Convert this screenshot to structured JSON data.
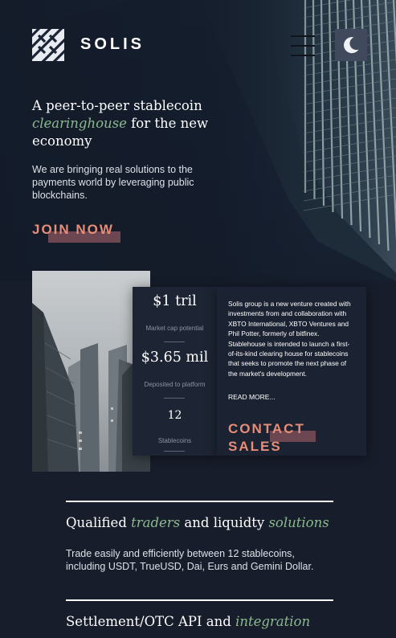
{
  "brand": {
    "name": "SOLIS"
  },
  "header": {
    "menu_icon": "hamburger-menu-icon",
    "theme_icon": "moon-icon"
  },
  "hero": {
    "title_a": "A peer-to-peer stablecoin",
    "title_em": "clearinghouse",
    "title_b": " for the new economy",
    "subtitle": "We are bringing real solutions to the payments world by leveraging public blockchains.",
    "cta_label": "JOIN NOW"
  },
  "stats": [
    {
      "value": "$1 tril",
      "label": "Market cap potential"
    },
    {
      "value": "$3.65 mil",
      "label": "Deposited to platform"
    },
    {
      "value": "12",
      "label": "Stablecoins"
    }
  ],
  "about": {
    "text": "Solis group is a new venture created with investments from and collaboration with XBTO International, XBTO Ventures and Phil Potter, formerly of bitfinex. Stablehouse is intended to launch a first-of-its-kind clearing house for stablecoins that seeks to promote the next phase of the market's development.",
    "read_more": "READ MORE...",
    "cta_label": "CONTACT SALES"
  },
  "sections": [
    {
      "title_a": "Qualified ",
      "title_em1": "traders",
      "title_b": " and liquidty ",
      "title_em2": "solutions",
      "text": "Trade easily and efficiently between 12 stablecoins, including USDT, TrueUSD, Dai, Eurs and Gemini Dollar."
    },
    {
      "title_a": "Settlement/OTC API and ",
      "title_em1": "integration"
    }
  ],
  "colors": {
    "background": "#171d2b",
    "accent": "#e88d78",
    "highlight": "#8cba8f",
    "cta_bar": "#6c4650"
  }
}
